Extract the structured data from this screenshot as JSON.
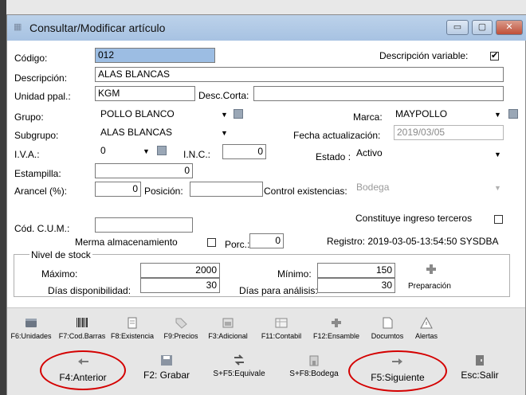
{
  "window": {
    "title": "Consultar/Modificar artículo",
    "controls": {
      "minimize": "▭",
      "maximize": "▢",
      "close": "✕"
    }
  },
  "form": {
    "codigo_label": "Código:",
    "codigo_value": "012",
    "desc_variable_label": "Descripción variable:",
    "desc_variable_checked": true,
    "check_mark": "✔",
    "descripcion_label": "Descripción:",
    "descripcion_value": "ALAS BLANCAS",
    "unidad_label": "Unidad ppal.:",
    "unidad_value": "KGM",
    "desc_corta_label": "Desc.Corta:",
    "desc_corta_value": "",
    "grupo_label": "Grupo:",
    "grupo_value": "POLLO BLANCO",
    "marca_label": "Marca:",
    "marca_value": "MAYPOLLO",
    "subgrupo_label": "Subgrupo:",
    "subgrupo_value": "ALAS BLANCAS",
    "fecha_label": "Fecha actualización:",
    "fecha_value": "2019/03/05",
    "iva_label": "I.V.A.:",
    "iva_value": "0",
    "inc_label": "I.N.C.:",
    "inc_value": "0",
    "estado_label": "Estado :",
    "estado_value": "Activo",
    "estampilla_label": "Estampilla:",
    "estampilla_value": "0",
    "arancel_label": "Arancel (%):",
    "arancel_value": "0",
    "posicion_label": "Posición:",
    "posicion_value": "",
    "control_label": "Control existencias:",
    "control_value": "Bodega",
    "constituye_label": "Constituye ingreso terceros",
    "cum_label": "Cód. C.U.M.:",
    "cum_value": "",
    "merma_label": "Merma almacenamiento",
    "porc_label": "Porc.:",
    "porc_value": "0",
    "registro_text": "Registro: 2019-03-05-13:54:50 SYSDBA",
    "arrow": "▼"
  },
  "stock": {
    "legend": "Nivel de stock",
    "maximo_label": "Máximo:",
    "maximo_value": "2000",
    "minimo_label": "Mínimo:",
    "minimo_value": "150",
    "dias_disp_label": "Días disponibilidad:",
    "dias_disp_value": "30",
    "dias_anal_label": "Días para análisis:",
    "dias_anal_value": "30",
    "preparacion_label": "Preparación"
  },
  "toolbar": {
    "row1": [
      {
        "label": "F6:Unidades",
        "icon": "units-icon"
      },
      {
        "label": "F7:Cod.Barras",
        "icon": "barcode-icon"
      },
      {
        "label": "F8:Existencia",
        "icon": "stock-icon"
      },
      {
        "label": "F9:Precios",
        "icon": "price-tag-icon"
      },
      {
        "label": "F3:Adicional",
        "icon": "additional-icon"
      },
      {
        "label": "F11:Contabil",
        "icon": "accounting-icon"
      },
      {
        "label": "F12:Ensamble",
        "icon": "puzzle-icon"
      },
      {
        "label": "Documtos",
        "icon": "document-icon"
      },
      {
        "label": "Alertas",
        "icon": "alert-icon"
      }
    ],
    "row2": [
      {
        "label": "F4:Anterior",
        "icon": "arrow-left-icon"
      },
      {
        "label": "F2: Grabar",
        "icon": "save-icon"
      },
      {
        "label": "S+F5:Equivale",
        "icon": "equivalence-icon"
      },
      {
        "label": "S+F8:Bodega",
        "icon": "warehouse-icon"
      },
      {
        "label": "F5:Siguiente",
        "icon": "arrow-right-icon"
      },
      {
        "label": "Esc:Salir",
        "icon": "exit-icon"
      }
    ]
  },
  "colors": {
    "title_bar": "#a7c2e2",
    "highlight_circle": "#d40000",
    "selection": "#9cbde3"
  }
}
